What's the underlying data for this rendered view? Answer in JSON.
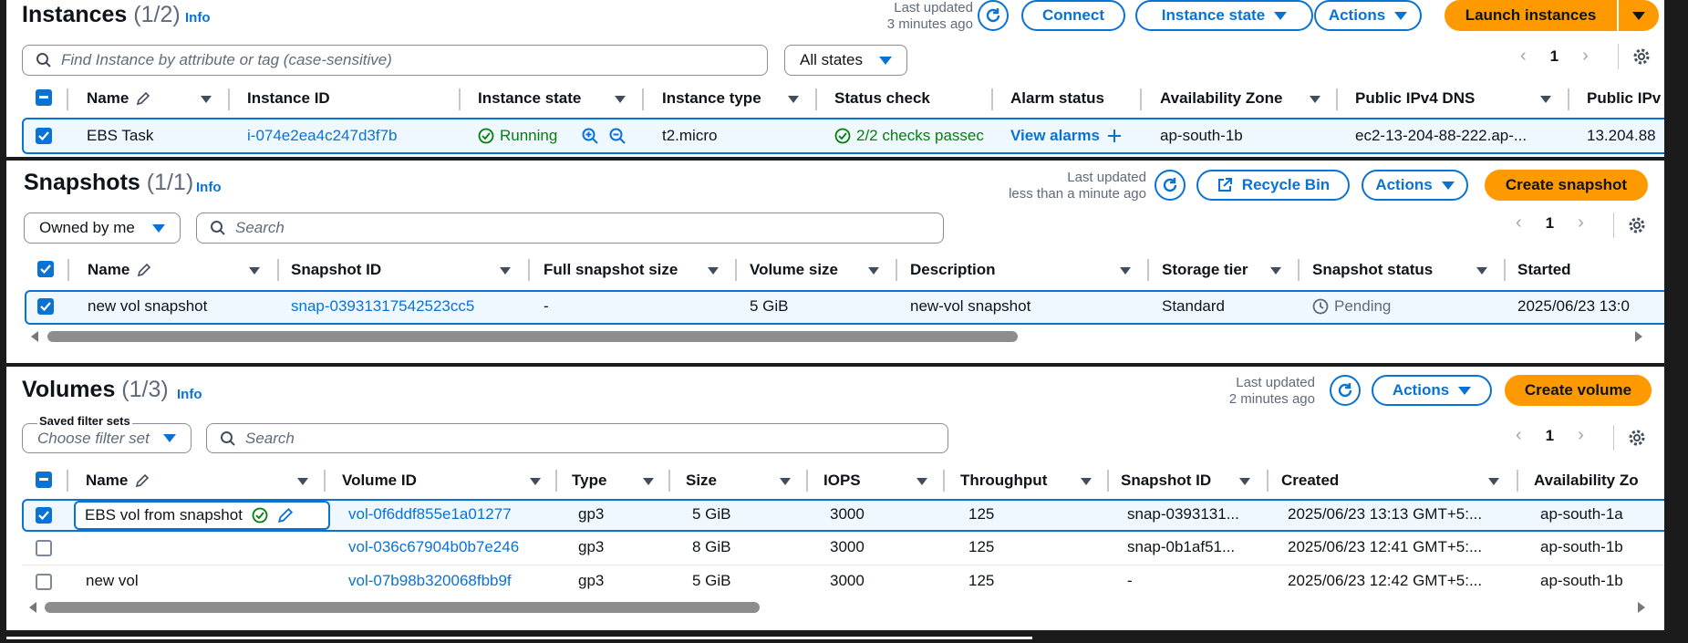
{
  "instances": {
    "title": "Instances",
    "count": "(1/2)",
    "info": "Info",
    "last_updated_1": "Last updated",
    "last_updated_2": "3 minutes ago",
    "connect": "Connect",
    "instance_state": "Instance state",
    "actions": "Actions",
    "launch": "Launch instances",
    "search_placeholder": "Find Instance by attribute or tag (case-sensitive)",
    "states_filter": "All states",
    "page": "1",
    "columns": [
      "Name",
      "Instance ID",
      "Instance state",
      "Instance type",
      "Status check",
      "Alarm status",
      "Availability Zone",
      "Public IPv4 DNS",
      "Public IPv"
    ],
    "row": {
      "name": "EBS Task",
      "id": "i-074e2ea4c247d3f7b",
      "state": "Running",
      "type": "t2.micro",
      "status": "2/2 checks passec",
      "alarm": "View alarms",
      "az": "ap-south-1b",
      "dns": "ec2-13-204-88-222.ap-...",
      "ip": "13.204.88"
    }
  },
  "snapshots": {
    "title": "Snapshots",
    "count": "(1/1)",
    "info": "Info",
    "last_updated_1": "Last updated",
    "last_updated_2": "less than a minute ago",
    "recycle_bin": "Recycle Bin",
    "actions": "Actions",
    "create": "Create snapshot",
    "owner_filter": "Owned by me",
    "search_placeholder": "Search",
    "page": "1",
    "columns": [
      "Name",
      "Snapshot ID",
      "Full snapshot size",
      "Volume size",
      "Description",
      "Storage tier",
      "Snapshot status",
      "Started"
    ],
    "row": {
      "name": "new vol snapshot",
      "id": "snap-03931317542523cc5",
      "full_size": "-",
      "vol_size": "5 GiB",
      "description": "new-vol snapshot",
      "tier": "Standard",
      "status": "Pending",
      "started": "2025/06/23 13:0"
    }
  },
  "volumes": {
    "title": "Volumes",
    "count": "(1/3)",
    "info": "Info",
    "last_updated_1": "Last updated",
    "last_updated_2": "2 minutes ago",
    "actions": "Actions",
    "create": "Create volume",
    "saved_filter_label": "Saved filter sets",
    "saved_filter_placeholder": "Choose filter set",
    "search_placeholder": "Search",
    "page": "1",
    "columns": [
      "Name",
      "Volume ID",
      "Type",
      "Size",
      "IOPS",
      "Throughput",
      "Snapshot ID",
      "Created",
      "Availability Zo"
    ],
    "rows": [
      {
        "name": "EBS vol from snapshot",
        "id": "vol-0f6ddf855e1a01277",
        "type": "gp3",
        "size": "5 GiB",
        "iops": "3000",
        "throughput": "125",
        "snapshot": "snap-0393131...",
        "created": "2025/06/23 13:13 GMT+5:...",
        "az": "ap-south-1a"
      },
      {
        "name": "",
        "id": "vol-036c67904b0b7e246",
        "type": "gp3",
        "size": "8 GiB",
        "iops": "3000",
        "throughput": "125",
        "snapshot": "snap-0b1af51...",
        "created": "2025/06/23 12:41 GMT+5:...",
        "az": "ap-south-1b"
      },
      {
        "name": "new vol",
        "id": "vol-07b98b320068fbb9f",
        "type": "gp3",
        "size": "5 GiB",
        "iops": "3000",
        "throughput": "125",
        "snapshot": "-",
        "created": "2025/06/23 12:42 GMT+5:...",
        "az": "ap-south-1b"
      }
    ]
  },
  "colors": {
    "accent": "#0972d3",
    "primary": "#ff9900",
    "success": "#037f0c"
  }
}
